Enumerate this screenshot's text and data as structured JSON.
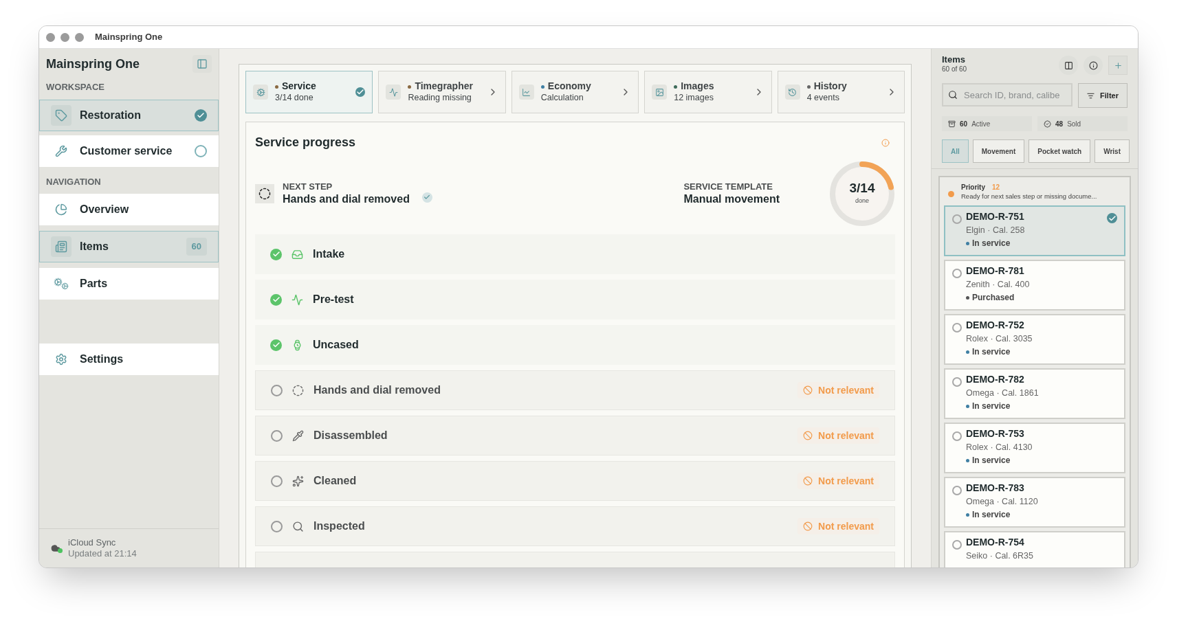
{
  "window": {
    "title": "Mainspring One"
  },
  "sidebar": {
    "title": "Mainspring One",
    "workspace_heading": "WORKSPACE",
    "workspaces": [
      {
        "label": "Restoration",
        "selected": true
      },
      {
        "label": "Customer service",
        "selected": false
      }
    ],
    "navigation_heading": "NAVIGATION",
    "navigation": [
      {
        "label": "Overview",
        "selected": false
      },
      {
        "label": "Items",
        "selected": true,
        "count": "60"
      },
      {
        "label": "Parts",
        "selected": false
      }
    ],
    "settings": {
      "label": "Settings",
      "selected": false
    },
    "sync": {
      "title": "iCloud Sync",
      "status": "Updated at 21:14"
    }
  },
  "tabs": [
    {
      "title": "Service",
      "subtitle": "3/14 done",
      "selected": true,
      "color": "#8a6a42"
    },
    {
      "title": "Timegrapher",
      "subtitle": "Reading missing",
      "selected": false,
      "color": "#8a6a42"
    },
    {
      "title": "Economy",
      "subtitle": "Calculation",
      "selected": false,
      "color": "#3f7fa3"
    },
    {
      "title": "Images",
      "subtitle": "12 images",
      "selected": false,
      "color": "#3e6b5a"
    },
    {
      "title": "History",
      "subtitle": "4 events",
      "selected": false,
      "color": "#666666"
    }
  ],
  "service_progress": {
    "title": "Service progress",
    "next_step": {
      "label": "NEXT STEP",
      "value": "Hands and dial removed"
    },
    "template": {
      "label": "SERVICE TEMPLATE",
      "value": "Manual movement"
    },
    "progress": {
      "reading": "3/14",
      "caption": "done",
      "level": 0.214
    },
    "steps": [
      {
        "label": "Intake",
        "done": true
      },
      {
        "label": "Pre-test",
        "done": true
      },
      {
        "label": "Uncased",
        "done": true
      },
      {
        "label": "Hands and dial removed",
        "done": false,
        "badge": "Not relevant"
      },
      {
        "label": "Disassembled",
        "done": false,
        "badge": "Not relevant"
      },
      {
        "label": "Cleaned",
        "done": false,
        "badge": "Not relevant"
      },
      {
        "label": "Inspected",
        "done": false,
        "badge": "Not relevant"
      }
    ]
  },
  "items_panel": {
    "title": "Items",
    "subtitle": "60 of 60",
    "search": {
      "placeholder": "Search ID, brand, calibe"
    },
    "filter_button": "Filter",
    "stats": [
      {
        "count": "60",
        "label": "Active"
      },
      {
        "count": "48",
        "label": "Sold"
      }
    ],
    "categories": [
      {
        "label": "All",
        "selected": true
      },
      {
        "label": "Movement",
        "selected": false
      },
      {
        "label": "Pocket watch",
        "selected": false
      },
      {
        "label": "Wrist",
        "selected": false
      }
    ],
    "priority": {
      "title": "Priority",
      "count": "12",
      "description": "Ready for next sales step or missing docume..."
    },
    "items": [
      {
        "id": "DEMO-R-751",
        "model": "Elgin · Cal. 258",
        "status": "In service",
        "color": "#3f7fa3",
        "selected": true
      },
      {
        "id": "DEMO-R-781",
        "model": "Zenith · Cal. 400",
        "status": "Purchased",
        "color": "#555555",
        "selected": false
      },
      {
        "id": "DEMO-R-752",
        "model": "Rolex · Cal. 3035",
        "status": "In service",
        "color": "#3f7fa3",
        "selected": false
      },
      {
        "id": "DEMO-R-782",
        "model": "Omega · Cal. 1861",
        "status": "In service",
        "color": "#3f7fa3",
        "selected": false
      },
      {
        "id": "DEMO-R-753",
        "model": "Rolex · Cal. 4130",
        "status": "In service",
        "color": "#3f7fa3",
        "selected": false
      },
      {
        "id": "DEMO-R-783",
        "model": "Omega · Cal. 1120",
        "status": "In service",
        "color": "#3f7fa3",
        "selected": false
      },
      {
        "id": "DEMO-R-754",
        "model": "Seiko · Cal. 6R35",
        "selected": false
      }
    ]
  }
}
